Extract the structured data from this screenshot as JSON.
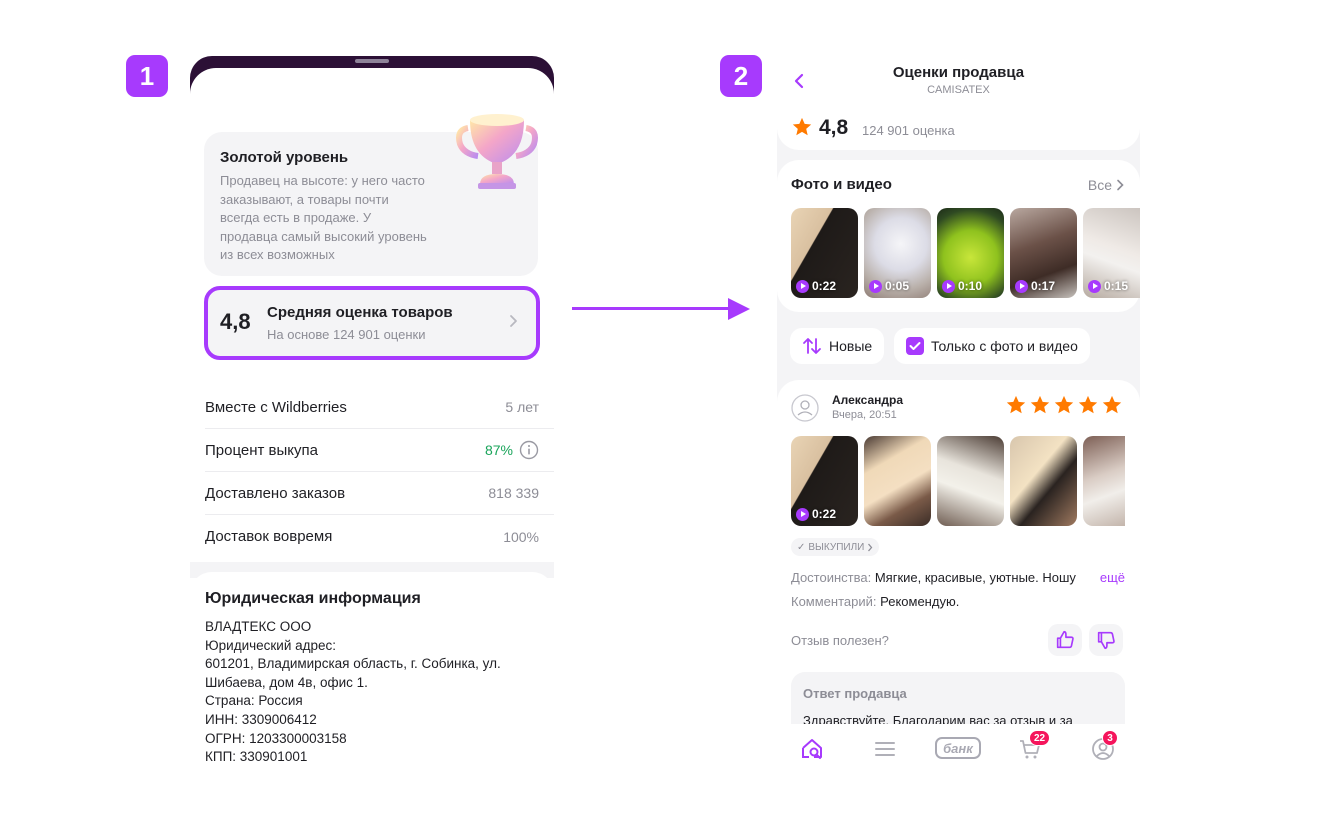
{
  "steps": {
    "one": "1",
    "two": "2"
  },
  "colors": {
    "accent": "#a73afd",
    "green": "#19a45a",
    "star": "#ff7a00",
    "badge": "#f5155c"
  },
  "screen1": {
    "gold": {
      "title": "Золотой уровень",
      "lines": [
        "Продавец на высоте: у него часто",
        "заказывают, а товары почти",
        "всегда есть в продаже. У",
        "продавца самый высокий уровень",
        "из всех возможных"
      ],
      "icon": "trophy-icon"
    },
    "rating": {
      "value": "4,8",
      "title": "Средняя оценка товаров",
      "subtitle": "На основе 124 901 оценки"
    },
    "stats": [
      {
        "label": "Вместе с Wildberries",
        "value": "5 лет"
      },
      {
        "label": "Процент выкупа",
        "value": "87%"
      },
      {
        "label": "Доставлено заказов",
        "value": "818 339"
      },
      {
        "label": "Доставок вовремя",
        "value": "100%"
      }
    ],
    "legal": {
      "title": "Юридическая информация",
      "lines": [
        "ВЛАДТЕКС ООО",
        "Юридический адрес:",
        "601201, Владимирская область, г. Собинка, ул.",
        "Шибаева, дом 4в, офис 1.",
        "Страна: Россия",
        "ИНН: 3309006412",
        "ОГРН: 1203300003158",
        "КПП: 330901001"
      ]
    }
  },
  "screen2": {
    "title": "Оценки продавца",
    "subtitle": "CAMISATEX",
    "rating": "4,8",
    "rating_count": "124 901 оценка",
    "media": {
      "title": "Фото и видео",
      "all_label": "Все",
      "durations": [
        "0:22",
        "0:05",
        "0:10",
        "0:17",
        "0:15"
      ]
    },
    "sort_label": "Новые",
    "filter_label": "Только с фото и видео",
    "review": {
      "author": "Александра",
      "date": "Вчера, 20:51",
      "stars": 5,
      "first_duration": "0:22",
      "bought": "ВЫКУПИЛИ",
      "pros_label": "Достоинства:",
      "pros_text": "Мягкие, красивые, уютные. Ношу",
      "more": "ещё",
      "comment_label": "Комментарий:",
      "comment_text": "Рекомендую.",
      "useful": "Отзыв полезен?",
      "reply_title": "Ответ продавца",
      "reply_text": "Здравствуйте. Благодарим вас за отзыв и за"
    },
    "tabbar": {
      "bank": "банк",
      "cart_count": "22",
      "profile_count": "3"
    }
  }
}
